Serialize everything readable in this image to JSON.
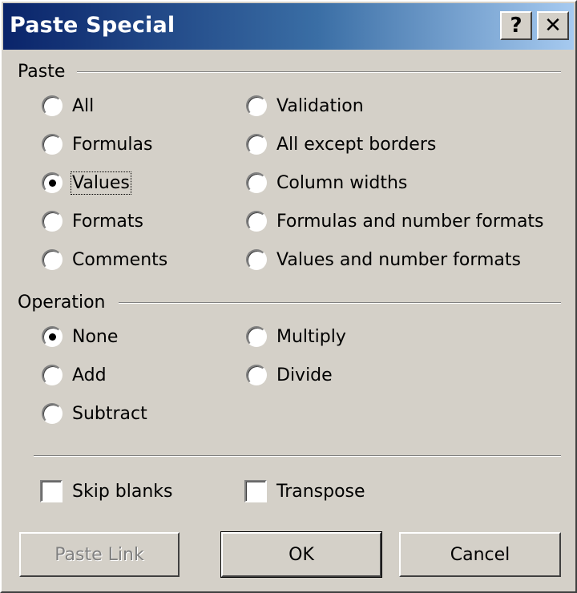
{
  "window": {
    "title": "Paste Special",
    "help_glyph": "?",
    "close_glyph": "✕"
  },
  "paste": {
    "group_label": "Paste",
    "left": [
      {
        "label": "All",
        "checked": false
      },
      {
        "label": "Formulas",
        "checked": false
      },
      {
        "label": "Values",
        "checked": true
      },
      {
        "label": "Formats",
        "checked": false
      },
      {
        "label": "Comments",
        "checked": false
      }
    ],
    "right": [
      {
        "label": "Validation",
        "checked": false
      },
      {
        "label": "All except borders",
        "checked": false
      },
      {
        "label": "Column widths",
        "checked": false
      },
      {
        "label": "Formulas and number formats",
        "checked": false
      },
      {
        "label": "Values and number formats",
        "checked": false
      }
    ]
  },
  "operation": {
    "group_label": "Operation",
    "left": [
      {
        "label": "None",
        "checked": true
      },
      {
        "label": "Add",
        "checked": false
      },
      {
        "label": "Subtract",
        "checked": false
      }
    ],
    "right": [
      {
        "label": "Multiply",
        "checked": false
      },
      {
        "label": "Divide",
        "checked": false
      }
    ]
  },
  "options": {
    "skip_blanks": {
      "label": "Skip blanks",
      "checked": false
    },
    "transpose": {
      "label": "Transpose",
      "checked": false
    }
  },
  "buttons": {
    "paste_link": "Paste Link",
    "ok": "OK",
    "cancel": "Cancel"
  }
}
